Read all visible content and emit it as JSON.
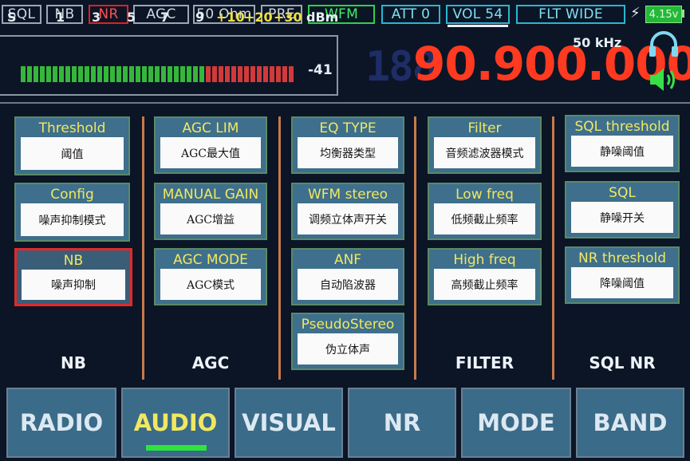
{
  "status_bar": {
    "buttons": [
      "SQL",
      "NB",
      "NR",
      "AGC",
      "50 Ohm",
      "PRE",
      "WFM",
      "ATT 0",
      "VOL 54",
      "FLT WIDE"
    ],
    "battery": "4.15v",
    "colors": {
      "active_red": "#e02020",
      "active_green": "#2ed14a",
      "accent_cyan": "#2bb6cf"
    }
  },
  "smeter": {
    "s_label": "S",
    "scale": [
      "1",
      "3",
      "5",
      "7",
      "9",
      "+10",
      "+20",
      "+30"
    ],
    "unit": "dBm",
    "reading": "-41"
  },
  "frequency": {
    "ghost_digits": "188",
    "value": "90.900.000",
    "step": "50 kHz"
  },
  "panels": [
    {
      "group": "NB",
      "items": [
        {
          "title": "Threshold",
          "value": "阈值"
        },
        {
          "title": "Config",
          "value": "噪声抑制模式"
        },
        {
          "title": "NB",
          "value": "噪声抑制"
        }
      ]
    },
    {
      "group": "AGC",
      "items": [
        {
          "title": "AGC LIM",
          "value": "AGC最大值"
        },
        {
          "title": "MANUAL GAIN",
          "value": "AGC增益"
        },
        {
          "title": "AGC MODE",
          "value": "AGC模式"
        }
      ]
    },
    {
      "group": "",
      "items": [
        {
          "title": "EQ TYPE",
          "value": "均衡器类型"
        },
        {
          "title": "WFM stereo",
          "value": "调频立体声开关"
        },
        {
          "title": "ANF",
          "value": "自动陷波器"
        },
        {
          "title": "PseudoStereo",
          "value": "伪立体声"
        }
      ]
    },
    {
      "group": "FILTER",
      "items": [
        {
          "title": "Filter",
          "value": "音频滤波器模式"
        },
        {
          "title": "Low freq",
          "value": "低频截止频率"
        },
        {
          "title": "High freq",
          "value": "高频截止频率"
        }
      ]
    },
    {
      "group": "SQL NR",
      "items": [
        {
          "title": "SQL threshold",
          "value": "静噪阈值"
        },
        {
          "title": "SQL",
          "value": "静噪开关"
        },
        {
          "title": "NR threshold",
          "value": "降噪阈值"
        }
      ]
    }
  ],
  "tabs": [
    "RADIO",
    "AUDIO",
    "VISUAL",
    "NR",
    "MODE",
    "BAND"
  ],
  "active_tab": "AUDIO",
  "icons": [
    "lightning-icon",
    "battery-icon",
    "headphones-icon",
    "speaker-icon"
  ]
}
